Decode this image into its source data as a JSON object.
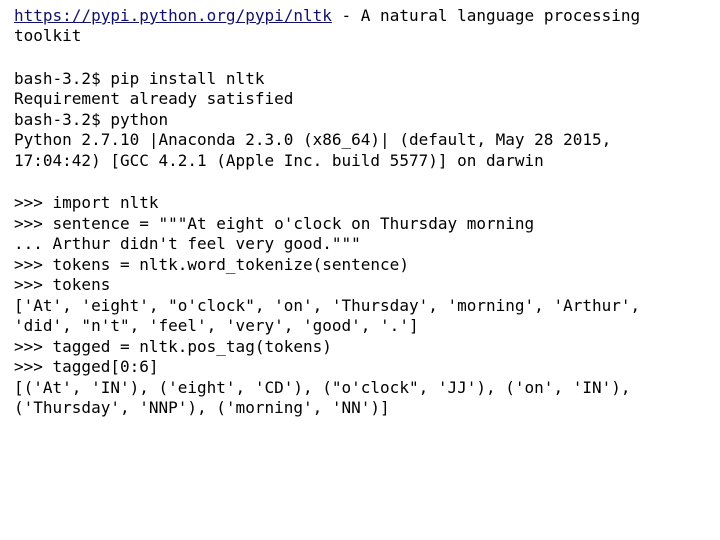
{
  "intro": {
    "url": "https://pypi.python.org/pypi/nltk",
    "desc": " - A natural language processing toolkit"
  },
  "shell_block": "bash-3.2$ pip install nltk\nRequirement already satisfied\nbash-3.2$ python\nPython 2.7.10 |Anaconda 2.3.0 (x86_64)| (default, May 28 2015, 17:04:42) [GCC 4.2.1 (Apple Inc. build 5577)] on darwin",
  "repl_block": ">>> import nltk\n>>> sentence = \"\"\"At eight o'clock on Thursday morning\n... Arthur didn't feel very good.\"\"\"\n>>> tokens = nltk.word_tokenize(sentence)\n>>> tokens\n['At', 'eight', \"o'clock\", 'on', 'Thursday', 'morning', 'Arthur', 'did', \"n't\", 'feel', 'very', 'good', '.']\n>>> tagged = nltk.pos_tag(tokens)\n>>> tagged[0:6]\n[('At', 'IN'), ('eight', 'CD'), (\"o'clock\", 'JJ'), ('on', 'IN'), ('Thursday', 'NNP'), ('morning', 'NN')]"
}
